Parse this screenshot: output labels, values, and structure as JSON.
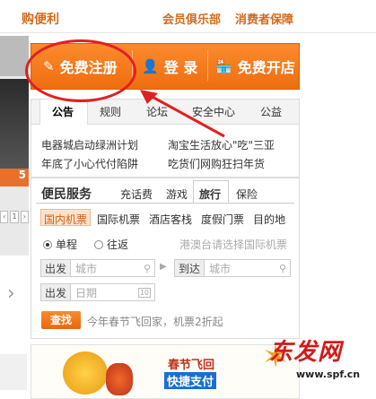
{
  "top": {
    "left_title": "购便利",
    "right_links": [
      "会员俱乐部",
      "消费者保障"
    ]
  },
  "left_carousel": {
    "badge": "5",
    "pager": [
      "‹",
      "1",
      "2",
      "›"
    ],
    "next_icon": "chevron-right-icon"
  },
  "action_bar": {
    "register": {
      "label": "免费注册",
      "icon": "pencil-icon"
    },
    "login": {
      "label": "登 录",
      "icon": "user-icon"
    },
    "open_store": {
      "label": "免费开店",
      "icon": "shop-icon"
    },
    "accent": "#f07a1a"
  },
  "notice": {
    "tabs": [
      "公告",
      "规则",
      "论坛",
      "安全中心",
      "公益"
    ],
    "active_tab": "公告",
    "items": [
      "电器城启动绿洲计划",
      "淘宝生活放心\"吃\"三亚",
      "年底了小心代付陷阱",
      "吃货们网购狂扫年货"
    ]
  },
  "services": {
    "title": "便民服务",
    "tabs": [
      "充话费",
      "游戏",
      "旅行",
      "保险"
    ],
    "active_tab": "旅行",
    "subtabs": [
      "国内机票",
      "国际机票",
      "酒店客栈",
      "度假门票",
      "目的地"
    ],
    "active_subtab": "国内机票",
    "trip_types": [
      "单程",
      "往返"
    ],
    "selected_trip": "单程",
    "hint": "港澳台请选择国际机票",
    "depart": {
      "label": "出发",
      "placeholder": "城市"
    },
    "arrive": {
      "label": "到达",
      "placeholder": "城市"
    },
    "date": {
      "label": "出发",
      "placeholder": "日期",
      "icon_text": "10"
    },
    "search_label": "查找",
    "promo": "今年春节飞回家，机票2折起"
  },
  "banner": {
    "text1": "春节飞回",
    "text2": "快捷支付"
  },
  "watermark": {
    "text": "东发网",
    "url": "www.spf.cn"
  }
}
